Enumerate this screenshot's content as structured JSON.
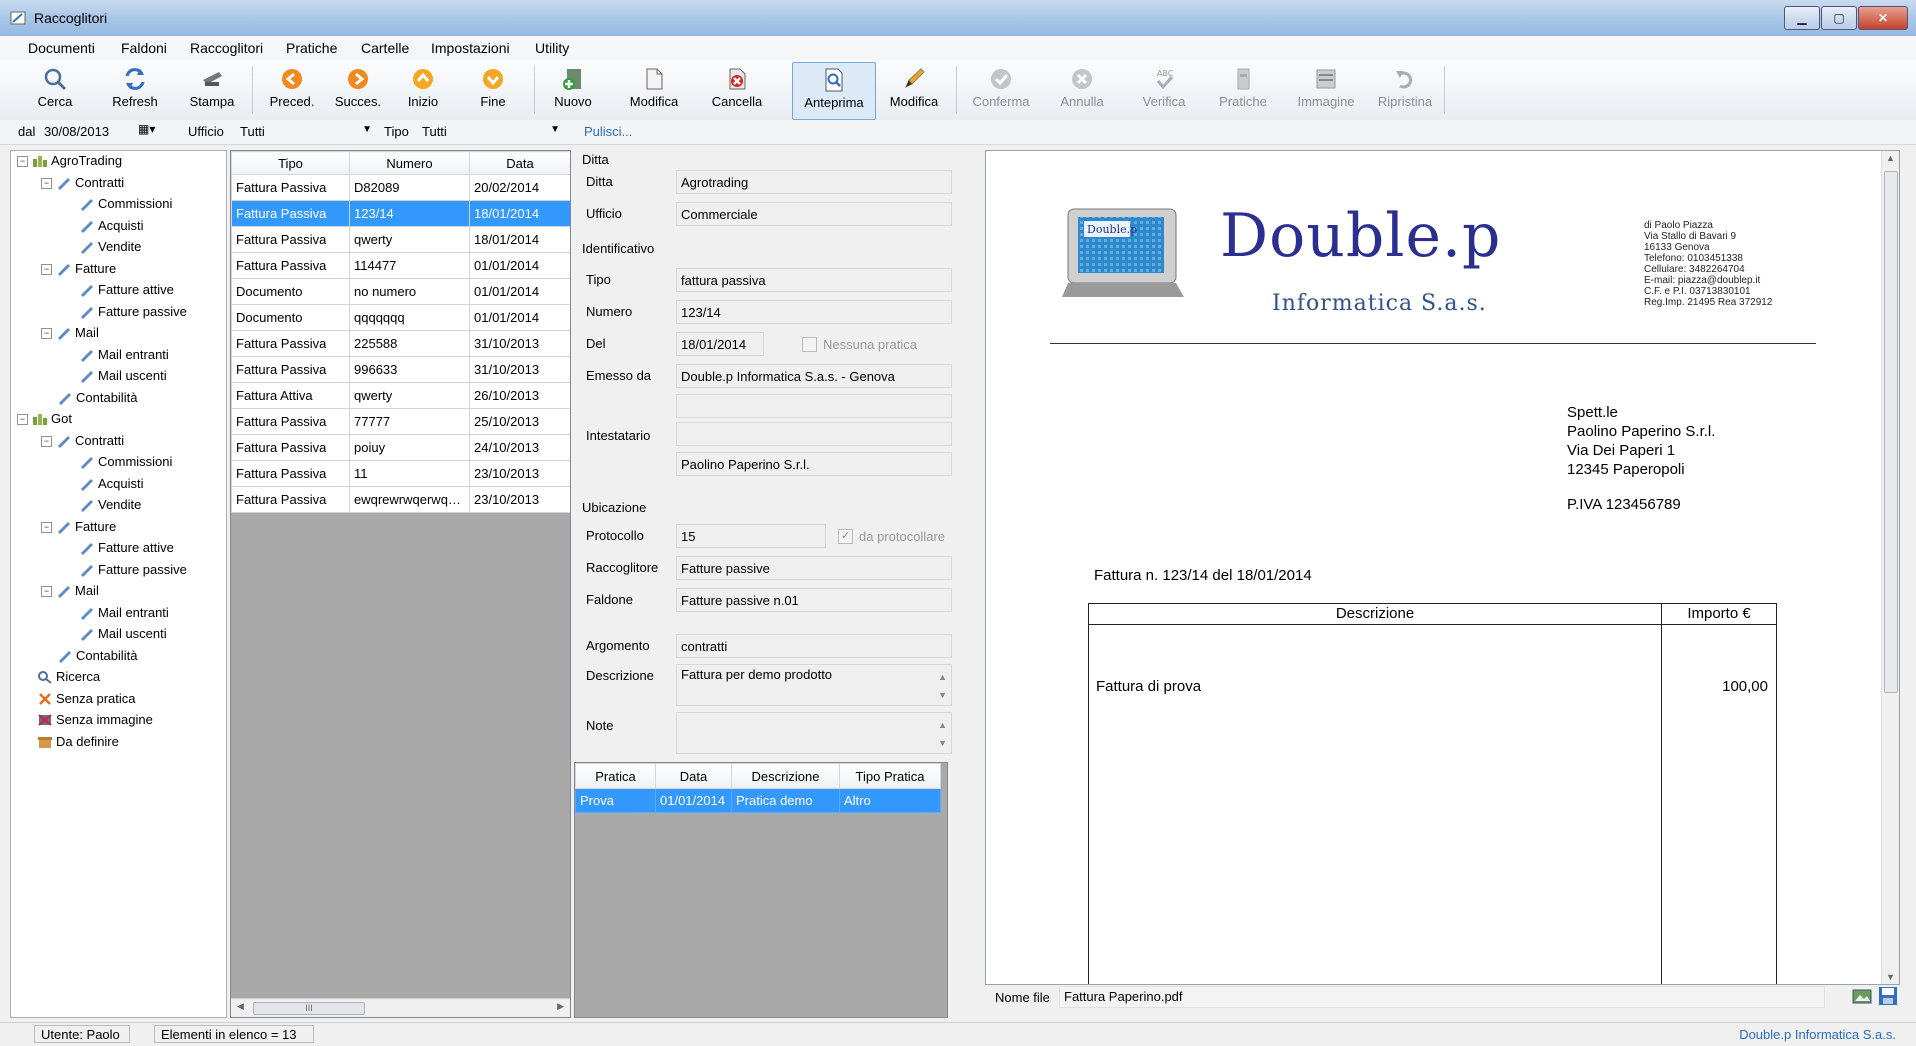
{
  "window": {
    "title": "Raccoglitori"
  },
  "menu": [
    "Documenti",
    "Faldoni",
    "Raccoglitori",
    "Pratiche",
    "Cartelle",
    "Impostazioni",
    "Utility"
  ],
  "toolbar": {
    "cerca": "Cerca",
    "refresh": "Refresh",
    "stampa": "Stampa",
    "preced": "Preced.",
    "succes": "Succes.",
    "inizio": "Inizio",
    "fine": "Fine",
    "nuovo": "Nuovo",
    "modifica": "Modifica",
    "cancella": "Cancella",
    "anteprima": "Anteprima",
    "modifica2": "Modifica",
    "conferma": "Conferma",
    "annulla": "Annulla",
    "verifica": "Verifica",
    "pratiche": "Pratiche",
    "immagine": "Immagine",
    "ripristina": "Ripristina"
  },
  "filter": {
    "dal_label": "dal",
    "dal_value": "30/08/2013",
    "ufficio_label": "Ufficio",
    "ufficio_value": "Tutti",
    "tipo_label": "Tipo",
    "tipo_value": "Tutti",
    "pulisci": "Pulisci..."
  },
  "tree": {
    "n0": "AgroTrading",
    "n1": "Contratti",
    "n2": "Commissioni",
    "n3": "Acquisti",
    "n4": "Vendite",
    "n5": "Fatture",
    "n6": "Fatture attive",
    "n7": "Fatture passive",
    "n8": "Mail",
    "n9": "Mail entranti",
    "n10": "Mail uscenti",
    "n11": "Contabilità",
    "n12": "Got",
    "n13": "Contratti",
    "n14": "Commissioni",
    "n15": "Acquisti",
    "n16": "Vendite",
    "n17": "Fatture",
    "n18": "Fatture attive",
    "n19": "Fatture passive",
    "n20": "Mail",
    "n21": "Mail entranti",
    "n22": "Mail uscenti",
    "n23": "Contabilità",
    "n24": "Ricerca",
    "n25": "Senza pratica",
    "n26": "Senza immagine",
    "n27": "Da definire"
  },
  "grid": {
    "headers": [
      "Tipo",
      "Numero",
      "Data"
    ],
    "rows": [
      [
        "Fattura Passiva",
        "D82089",
        "20/02/2014"
      ],
      [
        "Fattura Passiva",
        "123/14",
        "18/01/2014"
      ],
      [
        "Fattura Passiva",
        "qwerty",
        "18/01/2014"
      ],
      [
        "Fattura Passiva",
        "114477",
        "01/01/2014"
      ],
      [
        "Documento",
        "no numero",
        "01/01/2014"
      ],
      [
        "Documento",
        "qqqqqqq",
        "01/01/2014"
      ],
      [
        "Fattura Passiva",
        "225588",
        "31/10/2013"
      ],
      [
        "Fattura Passiva",
        "996633",
        "31/10/2013"
      ],
      [
        "Fattura Attiva",
        "qwerty",
        "26/10/2013"
      ],
      [
        "Fattura Passiva",
        "77777",
        "25/10/2013"
      ],
      [
        "Fattura Passiva",
        "poiuy",
        "24/10/2013"
      ],
      [
        "Fattura Passiva",
        "11",
        "23/10/2013"
      ],
      [
        "Fattura Passiva",
        "ewqrewrwqerwqe...",
        "23/10/2013"
      ]
    ]
  },
  "detail": {
    "sec_ditta": "Ditta",
    "ditta_label": "Ditta",
    "ditta_value": "Agrotrading",
    "ufficio_label": "Ufficio",
    "ufficio_value": "Commerciale",
    "sec_ident": "Identificativo",
    "tipo_label": "Tipo",
    "tipo_value": "fattura passiva",
    "numero_label": "Numero",
    "numero_value": "123/14",
    "del_label": "Del",
    "del_value": "18/01/2014",
    "nessuna_pratica": "Nessuna pratica",
    "emesso_label": "Emesso da",
    "emesso_value": "Double.p Informatica S.a.s. - Genova",
    "intestatario_label": "Intestatario",
    "intestatario_value": "Paolino Paperino S.r.l.",
    "sec_ubic": "Ubicazione",
    "protocollo_label": "Protocollo",
    "protocollo_value": "15",
    "da_protocollare": "da protocollare",
    "raccoglitore_label": "Raccoglitore",
    "raccoglitore_value": "Fatture passive",
    "faldone_label": "Faldone",
    "faldone_value": "Fatture passive n.01",
    "argomento_label": "Argomento",
    "argomento_value": "contratti",
    "descrizione_label": "Descrizione",
    "descrizione_value": "Fattura per demo prodotto",
    "note_label": "Note",
    "note_value": ""
  },
  "pratiche": {
    "headers": [
      "Pratica",
      "Data",
      "Descrizione",
      "Tipo Pratica"
    ],
    "row": [
      "Prova",
      "01/01/2014",
      "Pratica demo",
      "Altro"
    ]
  },
  "doc": {
    "logo_word": "Double.p",
    "brand": "Double.p",
    "sub": "Informatica S.a.s.",
    "addr": [
      "di Paolo Piazza",
      "Via Stallo di Bavari 9",
      "16133 Genova",
      "Telefono: 0103451338",
      "Cellulare: 3482264704",
      "E-mail:   piazza@doublep.it",
      "C.F. e P.I. 03713830101",
      "Reg.Imp. 21495  Rea 372912"
    ],
    "cust": [
      "Spett.le",
      "Paolino Paperino S.r.l.",
      "Via Dei Paperi 1",
      "12345 Paperopoli"
    ],
    "piva": "P.IVA 123456789",
    "title": "Fattura n. 123/14   del 18/01/2014",
    "col_desc": "Descrizione",
    "col_imp": "Importo €",
    "row_desc": "Fattura di prova",
    "row_imp": "100,00"
  },
  "bottom": {
    "nome_file_label": "Nome file",
    "nome_file_value": "Fattura Paperino.pdf"
  },
  "status": {
    "utente": "Utente: Paolo",
    "elementi": "Elementi in elenco = 13",
    "brand": "Double.p Informatica S.a.s."
  },
  "colors": {
    "selection": "#3399ff",
    "brand_blue": "#2b2f8f"
  }
}
